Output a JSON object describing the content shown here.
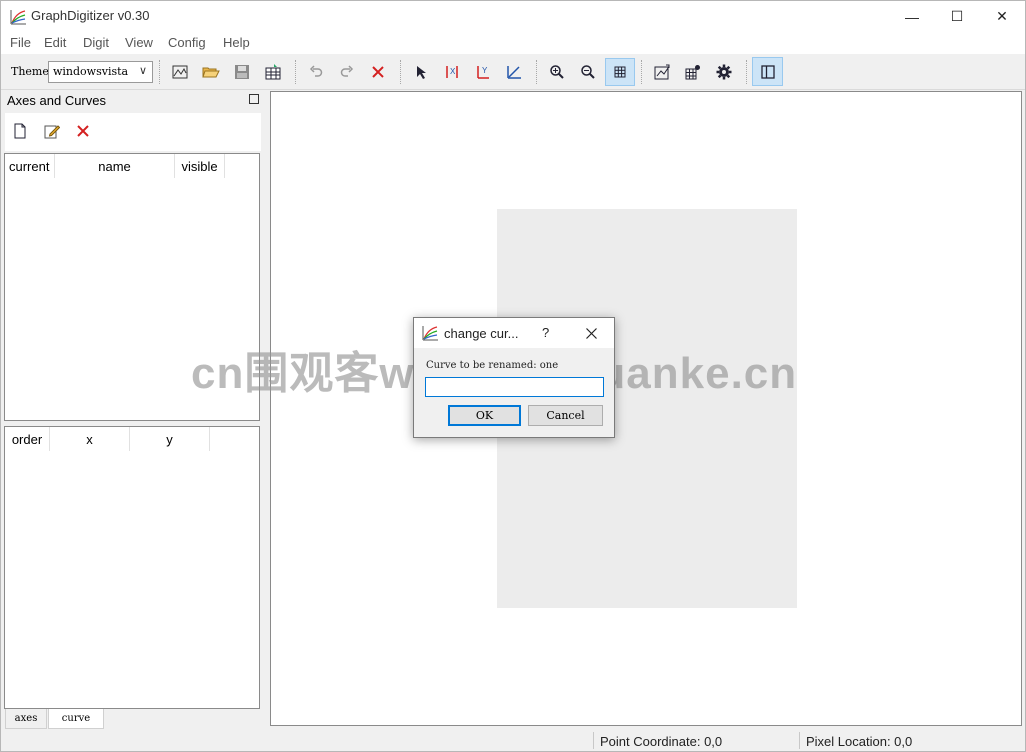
{
  "window": {
    "title": "GraphDigitizer v0.30",
    "controls": [
      "—",
      "☐",
      "✕"
    ]
  },
  "menubar": {
    "items": [
      "File",
      "Edit",
      "Digit",
      "View",
      "Config",
      "Help"
    ]
  },
  "toolbar": {
    "theme_label": "Theme",
    "theme_value": "windowsvista",
    "buttons": [
      "open-image-icon",
      "open-project-icon",
      "save-icon",
      "export-icon",
      "undo-icon",
      "redo-icon",
      "delete-icon",
      "select-point-icon",
      "set-x-axis-icon",
      "set-y-axis-icon",
      "axis-curve-icon",
      "zoom-in-icon",
      "zoom-out-icon",
      "grid-icon",
      "fit-curve-icon",
      "settings-grid-icon",
      "gear-icon",
      "panel-toggle-icon"
    ]
  },
  "dock": {
    "title": "Axes and Curves",
    "curves_table": {
      "headers": [
        "current",
        "name",
        "visible"
      ]
    },
    "points_table": {
      "headers": [
        "order",
        "x",
        "y"
      ]
    },
    "tabs": [
      "axes",
      "curve"
    ],
    "active_tab": "curve"
  },
  "statusbar": {
    "point_coordinate": "Point Coordinate: 0,0",
    "pixel_location": "Pixel Location: 0,0"
  },
  "dialog": {
    "title": "change cur...",
    "help": "?",
    "label": "Curve to be renamed: one",
    "input_value": "",
    "ok": "OK",
    "cancel": "Cancel"
  },
  "watermark": "cn围观客www.weiguanke.cn",
  "colors": {
    "accent": "#0078d7",
    "active_button_bg": "#cce4f7",
    "delete_red": "#d42020"
  }
}
